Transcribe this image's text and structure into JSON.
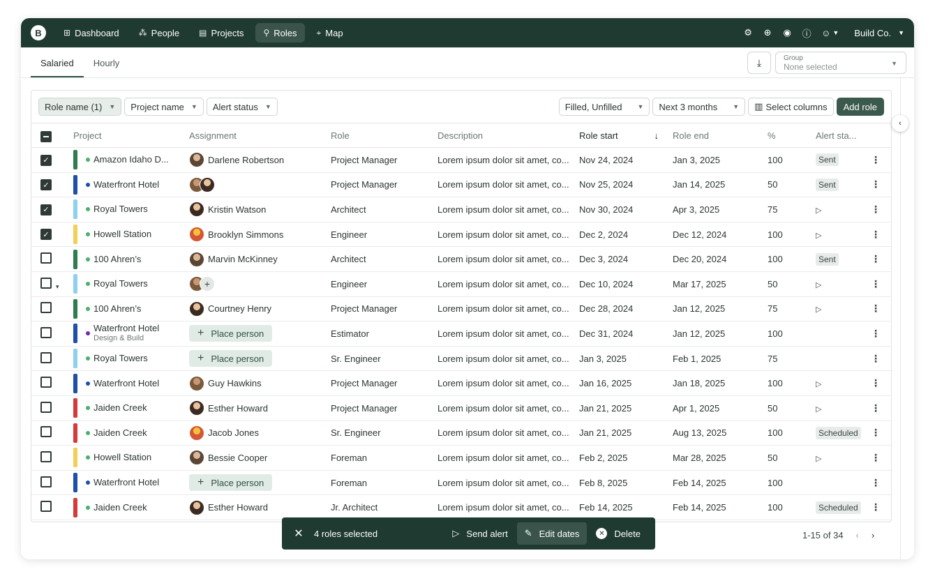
{
  "nav": {
    "logo": "B",
    "items": [
      {
        "label": "Dashboard",
        "icon": "⊞",
        "icon_name": "dashboard-icon",
        "active": false
      },
      {
        "label": "People",
        "icon": "⁂",
        "icon_name": "people-icon",
        "active": false
      },
      {
        "label": "Projects",
        "icon": "▤",
        "icon_name": "projects-icon",
        "active": false
      },
      {
        "label": "Roles",
        "icon": "⚲",
        "icon_name": "roles-icon",
        "active": true
      },
      {
        "label": "Map",
        "icon": "⌖",
        "icon_name": "map-icon",
        "active": false
      }
    ],
    "company": "Build Co."
  },
  "tabs": [
    "Salaried",
    "Hourly"
  ],
  "group_select": {
    "label": "Group",
    "value": "None selected"
  },
  "filters": {
    "left": [
      {
        "label": "Role name (1)",
        "active": true
      },
      {
        "label": "Project name",
        "active": false
      },
      {
        "label": "Alert status",
        "active": false
      }
    ],
    "right": [
      {
        "label": "Filled, Unfilled"
      },
      {
        "label": "Next 3 months"
      }
    ],
    "select_columns": "Select columns",
    "add_role": "Add role"
  },
  "columns": {
    "project": "Project",
    "assignment": "Assignment",
    "role": "Role",
    "description": "Description",
    "role_start": "Role start",
    "role_end": "Role end",
    "pct": "%",
    "alert": "Alert sta..."
  },
  "rows": [
    {
      "checked": true,
      "expand": false,
      "bar": "#2e7d4f",
      "dot": "#4caf6e",
      "project": "Amazon Idaho D...",
      "sub": "",
      "assign_type": "person",
      "person": "Darlene Robertson",
      "role": "Project Manager",
      "desc": "Lorem ipsum dolor sit amet, co...",
      "start": "Nov 24, 2024",
      "end": "Jan 3, 2025",
      "pct": "100",
      "alert": "Sent"
    },
    {
      "checked": true,
      "expand": false,
      "bar": "#1f4fa8",
      "dot": "#1f4fa8",
      "project": "Waterfront Hotel",
      "sub": "",
      "assign_type": "pair",
      "person": "",
      "role": "Project Manager",
      "desc": "Lorem ipsum dolor sit amet, co...",
      "start": "Nov 25, 2024",
      "end": "Jan 14, 2025",
      "pct": "50",
      "alert": "Sent"
    },
    {
      "checked": true,
      "expand": false,
      "bar": "#8fd0f0",
      "dot": "#4caf6e",
      "project": "Royal Towers",
      "sub": "",
      "assign_type": "person",
      "person": "Kristin Watson",
      "role": "Architect",
      "desc": "Lorem ipsum dolor sit amet, co...",
      "start": "Nov 30, 2024",
      "end": "Apr 3, 2025",
      "pct": "75",
      "alert": "send"
    },
    {
      "checked": true,
      "expand": false,
      "bar": "#f2cf57",
      "dot": "#4caf6e",
      "project": "Howell Station",
      "sub": "",
      "assign_type": "person",
      "person": "Brooklyn Simmons",
      "role": "Engineer",
      "desc": "Lorem ipsum dolor sit amet, co...",
      "start": "Dec 2, 2024",
      "end": "Dec 12, 2024",
      "pct": "100",
      "alert": "send"
    },
    {
      "checked": false,
      "expand": false,
      "bar": "#2e7d4f",
      "dot": "#4caf6e",
      "project": "100 Ahren’s",
      "sub": "",
      "assign_type": "person",
      "person": "Marvin McKinney",
      "role": "Architect",
      "desc": "Lorem ipsum dolor sit amet, co...",
      "start": "Dec 3, 2024",
      "end": "Dec 20, 2024",
      "pct": "100",
      "alert": "Sent"
    },
    {
      "checked": false,
      "expand": true,
      "bar": "#8fd0f0",
      "dot": "#4caf6e",
      "project": "Royal Towers",
      "sub": "",
      "assign_type": "plus",
      "person": "",
      "role": "Engineer",
      "desc": "Lorem ipsum dolor sit amet, co...",
      "start": "Dec 10, 2024",
      "end": "Mar 17, 2025",
      "pct": "50",
      "alert": "send"
    },
    {
      "checked": false,
      "expand": false,
      "bar": "#2e7d4f",
      "dot": "#4caf6e",
      "project": "100 Ahren’s",
      "sub": "",
      "assign_type": "person",
      "person": "Courtney Henry",
      "role": "Project Manager",
      "desc": "Lorem ipsum dolor sit amet, co...",
      "start": "Dec 28, 2024",
      "end": "Jan 12, 2025",
      "pct": "75",
      "alert": "send"
    },
    {
      "checked": false,
      "expand": false,
      "bar": "#1f4fa8",
      "dot": "#6a2fa8",
      "project": "Waterfront Hotel",
      "sub": "Design & Build",
      "assign_type": "place",
      "person": "Place person",
      "role": "Estimator",
      "desc": "Lorem ipsum dolor sit amet, co...",
      "start": "Dec 31, 2024",
      "end": "Jan 12, 2025",
      "pct": "100",
      "alert": ""
    },
    {
      "checked": false,
      "expand": false,
      "bar": "#8fd0f0",
      "dot": "#4caf6e",
      "project": "Royal Towers",
      "sub": "",
      "assign_type": "place",
      "person": "Place person",
      "role": "Sr. Engineer",
      "desc": "Lorem ipsum dolor sit amet, co...",
      "start": "Jan 3, 2025",
      "end": "Feb 1, 2025",
      "pct": "75",
      "alert": ""
    },
    {
      "checked": false,
      "expand": false,
      "bar": "#1f4fa8",
      "dot": "#1f4fa8",
      "project": "Waterfront Hotel",
      "sub": "",
      "assign_type": "person",
      "person": "Guy Hawkins",
      "role": "Project Manager",
      "desc": "Lorem ipsum dolor sit amet, co...",
      "start": "Jan 16, 2025",
      "end": "Jan 18, 2025",
      "pct": "100",
      "alert": "send"
    },
    {
      "checked": false,
      "expand": false,
      "bar": "#d63a3a",
      "dot": "#4caf6e",
      "project": "Jaiden Creek",
      "sub": "",
      "assign_type": "person",
      "person": "Esther Howard",
      "role": "Project Manager",
      "desc": "Lorem ipsum dolor sit amet, co...",
      "start": "Jan 21, 2025",
      "end": "Apr 1, 2025",
      "pct": "50",
      "alert": "send"
    },
    {
      "checked": false,
      "expand": false,
      "bar": "#d63a3a",
      "dot": "#4caf6e",
      "project": "Jaiden Creek",
      "sub": "",
      "assign_type": "person",
      "person": "Jacob Jones",
      "role": "Sr. Engineer",
      "desc": "Lorem ipsum dolor sit amet, co...",
      "start": "Jan 21, 2025",
      "end": "Aug 13, 2025",
      "pct": "100",
      "alert": "Scheduled"
    },
    {
      "checked": false,
      "expand": false,
      "bar": "#f2cf57",
      "dot": "#4caf6e",
      "project": "Howell Station",
      "sub": "",
      "assign_type": "person",
      "person": "Bessie Cooper",
      "role": "Foreman",
      "desc": "Lorem ipsum dolor sit amet, co...",
      "start": "Feb 2, 2025",
      "end": "Mar 28, 2025",
      "pct": "50",
      "alert": "send"
    },
    {
      "checked": false,
      "expand": false,
      "bar": "#1f4fa8",
      "dot": "#1f4fa8",
      "project": "Waterfront Hotel",
      "sub": "",
      "assign_type": "place",
      "person": "Place person",
      "role": "Foreman",
      "desc": "Lorem ipsum dolor sit amet, co...",
      "start": "Feb 8, 2025",
      "end": "Feb 14, 2025",
      "pct": "100",
      "alert": ""
    },
    {
      "checked": false,
      "expand": false,
      "bar": "#d63a3a",
      "dot": "#4caf6e",
      "project": "Jaiden Creek",
      "sub": "",
      "assign_type": "person",
      "person": "Esther Howard",
      "role": "Jr. Architect",
      "desc": "Lorem ipsum dolor sit amet, co...",
      "start": "Feb 14, 2025",
      "end": "Feb 14, 2025",
      "pct": "100",
      "alert": "Scheduled"
    }
  ],
  "pager": {
    "range": "1-15 of 34"
  },
  "action_bar": {
    "count": "4 roles selected",
    "send_alert": "Send alert",
    "edit_dates": "Edit dates",
    "delete": "Delete"
  }
}
